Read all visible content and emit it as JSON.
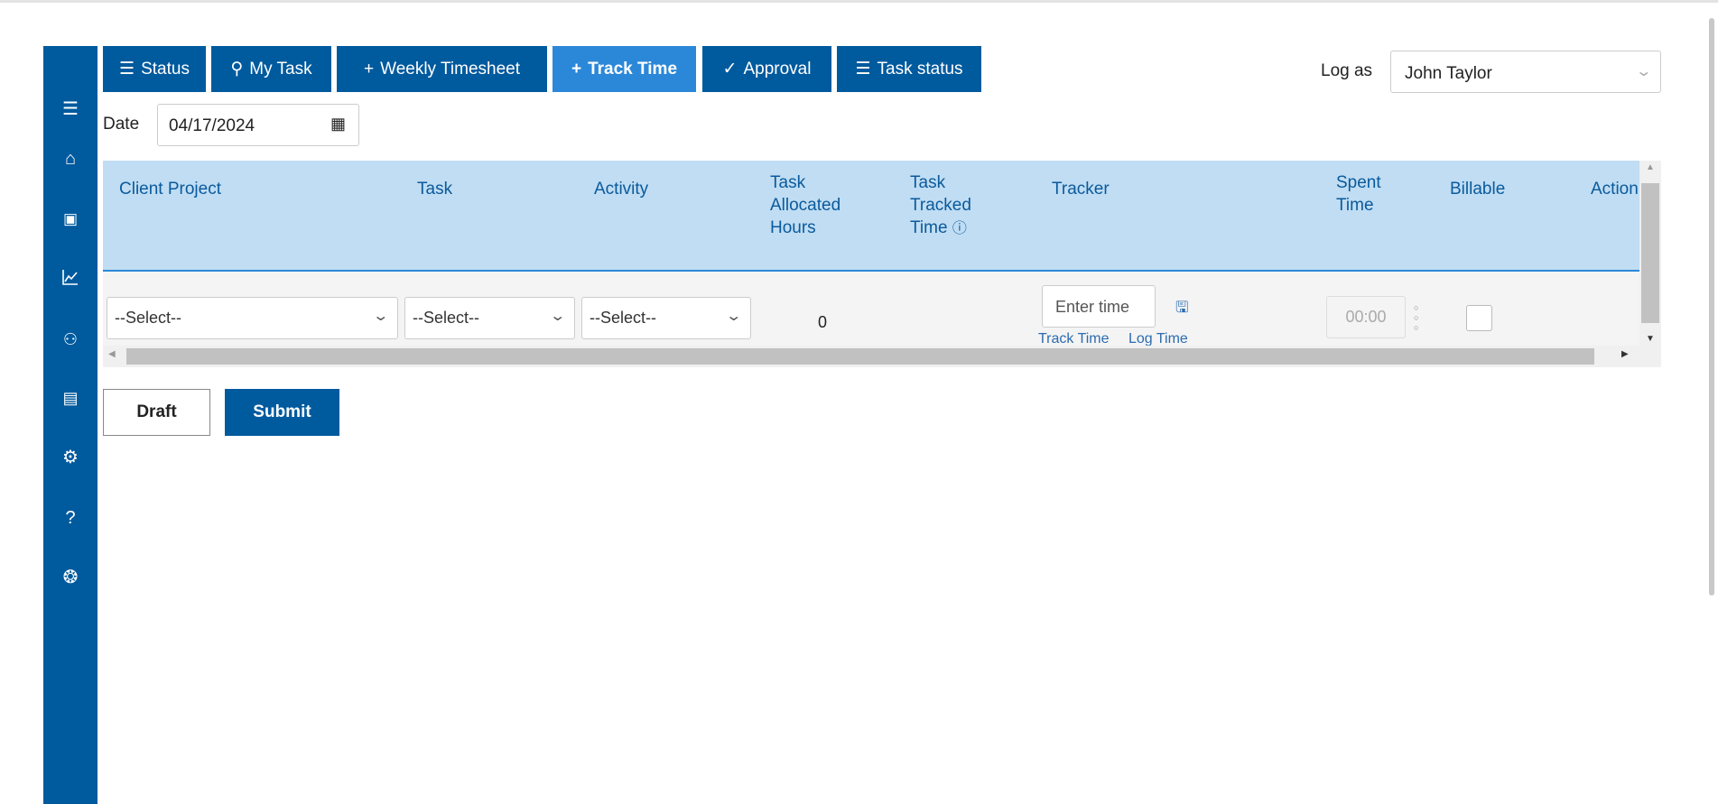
{
  "sidebar": {
    "items": [
      {
        "icon": "menu-icon",
        "glyph": "☰"
      },
      {
        "icon": "home-icon",
        "glyph": "⌂"
      },
      {
        "icon": "timesheet-icon",
        "glyph": "▣"
      },
      {
        "icon": "chart-icon",
        "glyph": "📈"
      },
      {
        "icon": "user-settings-icon",
        "glyph": "⚙"
      },
      {
        "icon": "report-icon",
        "glyph": "▤"
      },
      {
        "icon": "gear-icon",
        "glyph": "⚙"
      },
      {
        "icon": "help-icon",
        "glyph": "?"
      },
      {
        "icon": "billing-icon",
        "glyph": "❂"
      }
    ]
  },
  "nav": {
    "status": "Status",
    "my_task": "My Task",
    "weekly_timesheet": "Weekly Timesheet",
    "track_time": "Track Time",
    "approval": "Approval",
    "task_status": "Task status"
  },
  "colors": {
    "primary": "#005a9e",
    "active": "#2b88d8",
    "header_bg": "#c0ddf3"
  },
  "log_as": {
    "label": "Log as",
    "value": "John Taylor"
  },
  "date": {
    "label": "Date",
    "value": "04/17/2024"
  },
  "table": {
    "headers": {
      "client_project": "Client Project",
      "task": "Task",
      "activity": "Activity",
      "allocated_1": "Task",
      "allocated_2": "Allocated",
      "allocated_3": "Hours",
      "tracked_1": "Task",
      "tracked_2": "Tracked",
      "tracked_3": "Time",
      "tracker": "Tracker",
      "spent_1": "Spent",
      "spent_2": "Time",
      "billable": "Billable",
      "action": "Action"
    },
    "row": {
      "client_project": "--Select--",
      "task": "--Select--",
      "activity": "--Select--",
      "allocated_hours": "0",
      "tracker_placeholder": "Enter time",
      "track_time_link": "Track Time",
      "log_time_link": "Log Time",
      "spent_time_placeholder": "00:00",
      "billable": false
    }
  },
  "actions": {
    "draft": "Draft",
    "submit": "Submit"
  }
}
